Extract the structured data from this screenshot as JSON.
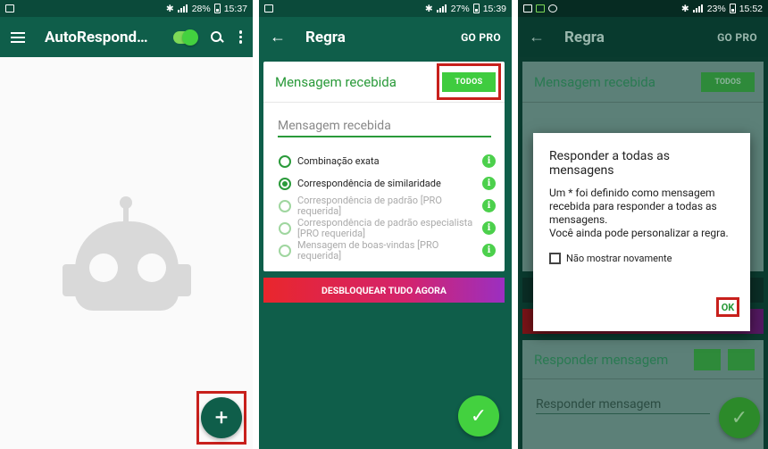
{
  "screen1": {
    "status": {
      "battery": "28%",
      "time": "15:37"
    },
    "toolbar": {
      "title": "AutoRespond…"
    },
    "fab_label": "+"
  },
  "screen2": {
    "status": {
      "battery": "27%",
      "time": "15:39"
    },
    "toolbar": {
      "back": "←",
      "title": "Regra",
      "action": "GO PRO"
    },
    "card": {
      "title": "Mensagem recebida",
      "todos": "TODOS",
      "input_placeholder": "Mensagem recebida",
      "options": [
        {
          "label": "Combinação exata",
          "checked": false,
          "disabled": false
        },
        {
          "label": "Correspondência de similaridade",
          "checked": true,
          "disabled": false
        },
        {
          "label": "Correspondência de padrão [PRO requerida]",
          "checked": false,
          "disabled": true
        },
        {
          "label": "Correspondência de padrão especialista [PRO requerida]",
          "checked": false,
          "disabled": true
        },
        {
          "label": "Mensagem de boas-vindas [PRO requerida]",
          "checked": false,
          "disabled": true
        }
      ]
    },
    "unlock_label": "DESBLOQUEAR TUDO AGORA",
    "fab_label": "✓"
  },
  "screen3": {
    "status": {
      "battery": "23%",
      "time": "15:52"
    },
    "toolbar": {
      "back": "←",
      "title": "Regra",
      "action": "GO PRO"
    },
    "bg_card_title": "Mensagem recebida",
    "bg_todos": "TODOS",
    "bg_reply_title": "Responder mensagem",
    "bg_reply_placeholder": "Responder mensagem",
    "dialog": {
      "title": "Responder a todas as mensagens",
      "text": "Um * foi definido como mensagem recebida para responder a todas as mensagens.\nVocê ainda pode personalizar a regra.",
      "checkbox": "Não mostrar novamente",
      "ok": "OK"
    },
    "fab_label": "✓"
  },
  "colors": {
    "primary": "#0f5e4a",
    "accent": "#43d13f",
    "highlight": "#c8201c"
  }
}
